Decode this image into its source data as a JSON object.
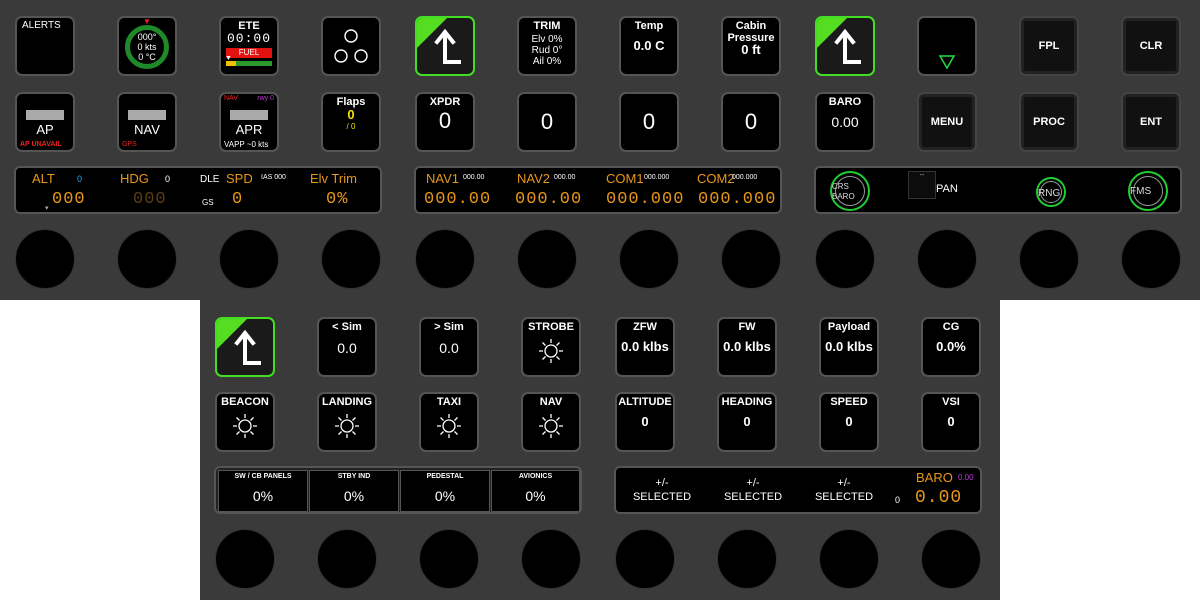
{
  "top": {
    "alerts": "ALERTS",
    "compass": {
      "hdg": "000°",
      "spd": "0 kts",
      "temp": "0 °C"
    },
    "ete": {
      "title": "ETE",
      "value": "00:00",
      "fuel": "FUEL"
    },
    "trim": {
      "title": "TRIM",
      "elv": "Elv 0%",
      "rud": "Rud 0°",
      "ail": "Ail 0%"
    },
    "temp": {
      "title": "Temp",
      "value": "0.0 C"
    },
    "cabin": {
      "title": "Cabin\nPressure",
      "value": "0 ft"
    },
    "fpl": "FPL",
    "clr": "CLR",
    "ap": {
      "label": "AP",
      "sub": "AP UNAVAIL"
    },
    "nav": {
      "label": "NAV",
      "sub": "GPS"
    },
    "apr": {
      "label": "APR",
      "tl": "NAV",
      "tr": "rwy 0",
      "sub": "VAPP ~0 kts"
    },
    "flaps": {
      "title": "Flaps",
      "value": "0",
      "sub": "/ 0"
    },
    "xpdr": {
      "title": "XPDR",
      "value": "0"
    },
    "zero1": "0",
    "zero2": "0",
    "zero3": "0",
    "baro": {
      "title": "BARO",
      "value": "0.00"
    },
    "menu": "MENU",
    "proc": "PROC",
    "ent": "ENT",
    "ap_strip": {
      "alt": "ALT",
      "alt_small": "0",
      "alt_val": "000",
      "hdg": "HDG",
      "hdg_small": "0",
      "hdg_val": "000",
      "dle": "DLE",
      "gs": "GS",
      "spd": "SPD",
      "spd_small": "IAS 000",
      "spd_val": "0",
      "elv": "Elv Trim",
      "elv_val": "0%"
    },
    "radio_strip": {
      "nav1": "NAV1",
      "nav1_sb": "000.00",
      "nav1_val": "000.00",
      "nav2": "NAV2",
      "nav2_sb": "000.00",
      "nav2_val": "000.00",
      "com1": "COM1",
      "com1_sb": "000.000",
      "com1_val": "000.000",
      "com2": "COM2",
      "com2_sb": "000.000",
      "com2_val": "000.000"
    },
    "fms_strip": {
      "crs": "CRS",
      "baro": "BARO",
      "dash": "--",
      "pan": "PAN",
      "rng": "RNG",
      "fms": "FMS"
    }
  },
  "bottom": {
    "less_sim": {
      "title": "< Sim",
      "value": "0.0"
    },
    "more_sim": {
      "title": "> Sim",
      "value": "0.0"
    },
    "strobe": "STROBE",
    "zfw": {
      "title": "ZFW",
      "value": "0.0 klbs"
    },
    "fw": {
      "title": "FW",
      "value": "0.0 klbs"
    },
    "payload": {
      "title": "Payload",
      "value": "0.0 klbs"
    },
    "cg": {
      "title": "CG",
      "value": "0.0%"
    },
    "beacon": "BEACON",
    "landing": "LANDING",
    "taxi": "TAXI",
    "nav": "NAV",
    "altitude": {
      "title": "ALTITUDE",
      "value": "0"
    },
    "heading": {
      "title": "HEADING",
      "value": "0"
    },
    "speed": {
      "title": "SPEED",
      "value": "0"
    },
    "vsi": {
      "title": "VSI",
      "value": "0"
    },
    "panels": [
      {
        "title": "SW / CB PANELS",
        "value": "0%"
      },
      {
        "title": "STBY IND",
        "value": "0%"
      },
      {
        "title": "PEDESTAL",
        "value": "0%"
      },
      {
        "title": "AVIONICS",
        "value": "0%"
      }
    ],
    "selected": {
      "pm": "+/-",
      "label": "SELECTED"
    },
    "baro_strip": {
      "title": "BARO",
      "small": "0.00",
      "zero": "0",
      "value": "0.00"
    }
  },
  "colors": {
    "accent_green": "#55dd22",
    "amber": "#e8961a",
    "cyan": "#2aa5ff",
    "ring_green": "#22cc33"
  }
}
